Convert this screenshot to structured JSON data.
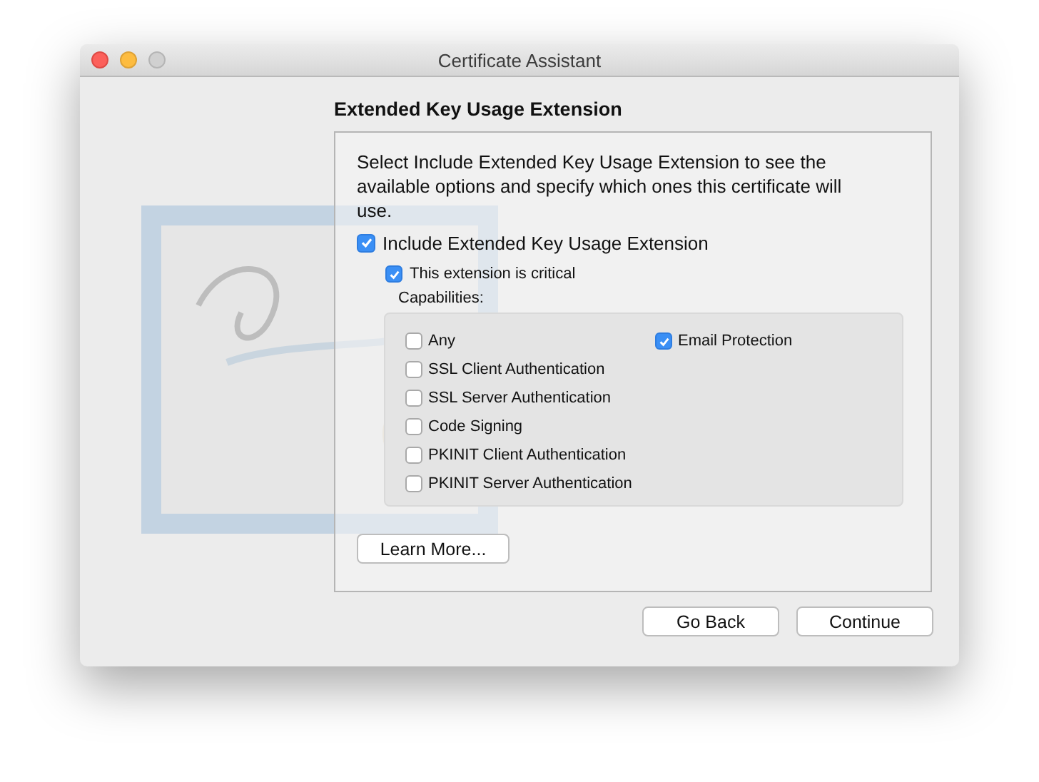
{
  "window": {
    "title": "Certificate Assistant"
  },
  "heading": "Extended Key Usage Extension",
  "description": "Select Include Extended Key Usage Extension to see the available options and specify which ones this certificate will use.",
  "include_option": {
    "label": "Include Extended Key Usage Extension",
    "checked": true
  },
  "critical_option": {
    "label": "This extension is critical",
    "checked": true
  },
  "capabilities_label": "Capabilities:",
  "capability_columns": [
    [
      {
        "label": "Any",
        "checked": false
      },
      {
        "label": "SSL Client Authentication",
        "checked": false
      },
      {
        "label": "SSL Server Authentication",
        "checked": false
      },
      {
        "label": "Code Signing",
        "checked": false
      },
      {
        "label": "PKINIT Client Authentication",
        "checked": false
      },
      {
        "label": "PKINIT Server Authentication",
        "checked": false
      }
    ],
    [
      {
        "label": "Email Protection",
        "checked": true
      }
    ]
  ],
  "learn_more_button": "Learn More...",
  "footer_buttons": [
    "Go Back",
    "Continue"
  ]
}
